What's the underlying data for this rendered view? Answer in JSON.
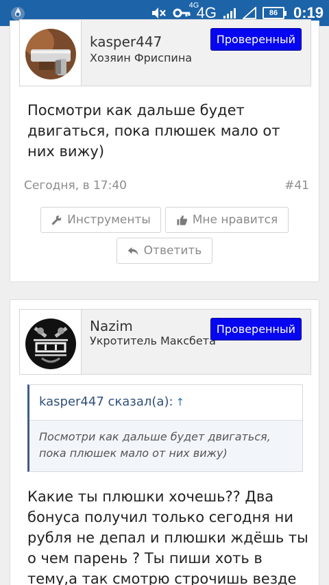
{
  "status_bar": {
    "network_small": "4G",
    "network": "4G",
    "battery": "86",
    "time": "0:19"
  },
  "posts": [
    {
      "username": "kasper447",
      "user_title": "Хозяин Фриспина",
      "badge": "Проверенный",
      "message": "Посмотри как дальше будет двигаться, пока плюшек мало от них вижу)",
      "date": "Сегодня, в 17:40",
      "number": "#41",
      "buttons": {
        "tools": "Инструменты",
        "like": "Мне нравится",
        "reply": "Ответить"
      }
    },
    {
      "username": "Nazim",
      "user_title": "Укротитель Максбета",
      "badge": "Проверенный",
      "quote": {
        "author": "kasper447 сказал(а):",
        "arrow": "↑",
        "text": "Посмотри как дальше будет двигаться, пока плюшек мало от них вижу)"
      },
      "message": "Какие ты плюшки хочешь?? Два бонуса получил только сегодня ни рубля не депал и плюшки ждёшь ты о чем парень ? Ты пиши хоть в тему,а так смотрю строчишь везде"
    }
  ]
}
